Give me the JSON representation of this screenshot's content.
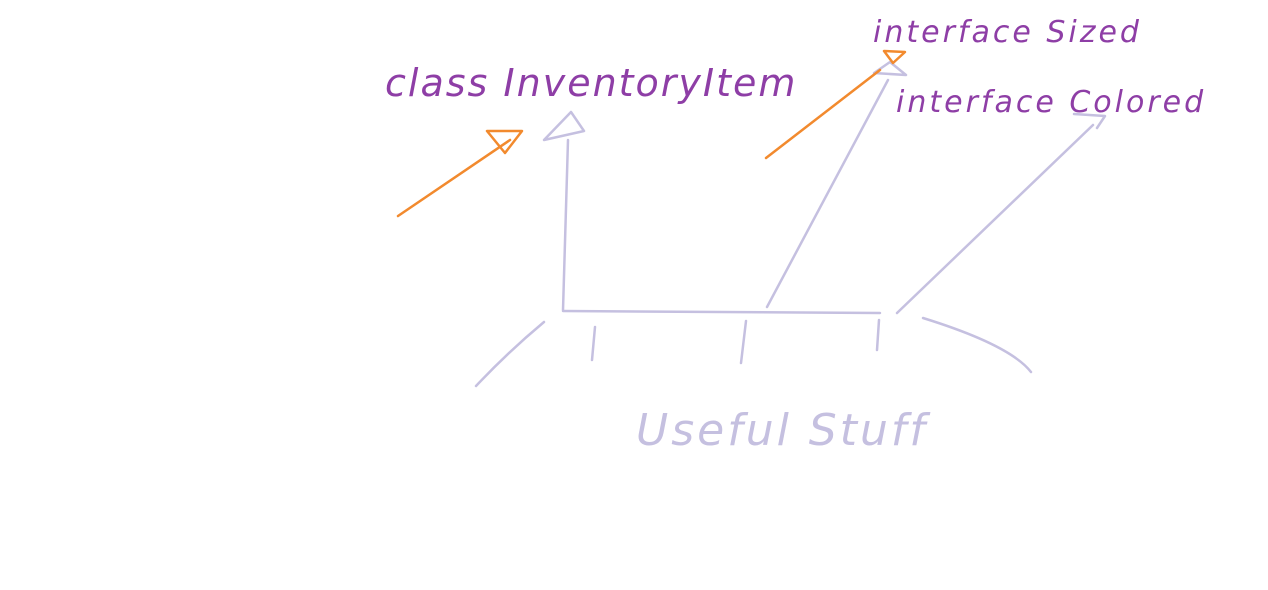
{
  "colors": {
    "background": "#ffffff",
    "label_purple": "#8e3ea6",
    "line_lavender": "#c5c0e0",
    "arrow_orange": "#f28a2e"
  },
  "labels": {
    "class_inventory_item": "class InventoryItem",
    "interface_sized": "interface Sized",
    "interface_colored": "interface Colored",
    "useful_stuff": "Useful Stuff"
  }
}
